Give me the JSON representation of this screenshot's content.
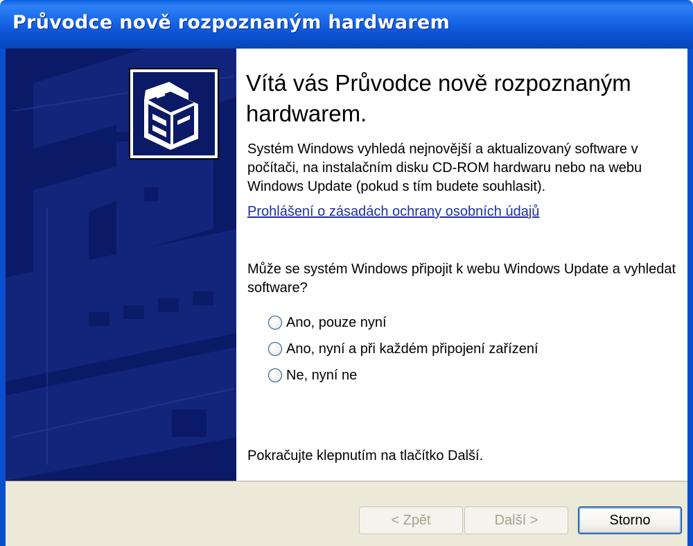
{
  "window": {
    "title": "Průvodce nově rozpoznaným hardwarem"
  },
  "banner": {
    "icon": "hardware-device-icon"
  },
  "content": {
    "heading": "Vítá vás Průvodce nově rozpoznaným hardwarem.",
    "description": "Systém Windows vyhledá nejnovější a aktualizovaný software v počítači, na instalačním disku CD-ROM hardwaru nebo na webu Windows Update (pokud s tím budete souhlasit).",
    "privacy_link": "Prohlášení o zásadách ochrany osobních údajů",
    "question": "Může se systém Windows připojit k webu Windows Update a vyhledat software?",
    "options": [
      {
        "label": "Ano, pouze nyní",
        "selected": false
      },
      {
        "label": "Ano, nyní a při každém připojení zařízení",
        "selected": false
      },
      {
        "label": "Ne, nyní ne",
        "selected": false
      }
    ],
    "continue_hint": "Pokračujte klepnutím na tlačítko Další."
  },
  "buttons": {
    "back": {
      "label": "< Zpět",
      "enabled": false
    },
    "next": {
      "label": "Další >",
      "enabled": false
    },
    "cancel": {
      "label": "Storno",
      "enabled": true
    }
  },
  "colors": {
    "titlebar": "#0b52d4",
    "banner": "#0b1a66",
    "link": "#1c2fa0",
    "dialog_bg": "#ece9d8"
  }
}
